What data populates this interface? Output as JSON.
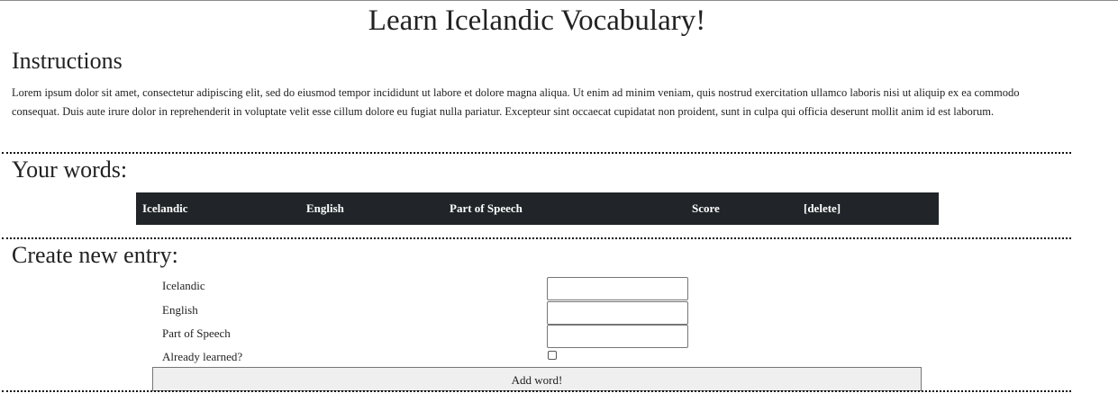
{
  "header": {
    "title": "Learn Icelandic Vocabulary!"
  },
  "instructions": {
    "heading": "Instructions",
    "body": "Lorem ipsum dolor sit amet, consectetur adipiscing elit, sed do eiusmod tempor incididunt ut labore et dolore magna aliqua. Ut enim ad minim veniam, quis nostrud exercitation ullamco laboris nisi ut aliquip ex ea commodo consequat. Duis aute irure dolor in reprehenderit in voluptate velit esse cillum dolore eu fugiat nulla pariatur. Excepteur sint occaecat cupidatat non proident, sunt in culpa qui officia deserunt mollit anim id est laborum."
  },
  "words": {
    "heading": "Your words:",
    "columns": [
      "Icelandic",
      "English",
      "Part of Speech",
      "Score",
      "[delete]"
    ]
  },
  "create": {
    "heading": "Create new entry:",
    "fields": {
      "icelandic": {
        "label": "Icelandic",
        "value": ""
      },
      "english": {
        "label": "English",
        "value": ""
      },
      "part_of_speech": {
        "label": "Part of Speech",
        "value": ""
      },
      "already_learned": {
        "label": "Already learned?",
        "checked": false
      }
    },
    "submit_label": "Add word!"
  },
  "colors": {
    "table_header_bg": "#212529",
    "table_header_text": "#ffffff",
    "button_bg": "#efefef"
  }
}
